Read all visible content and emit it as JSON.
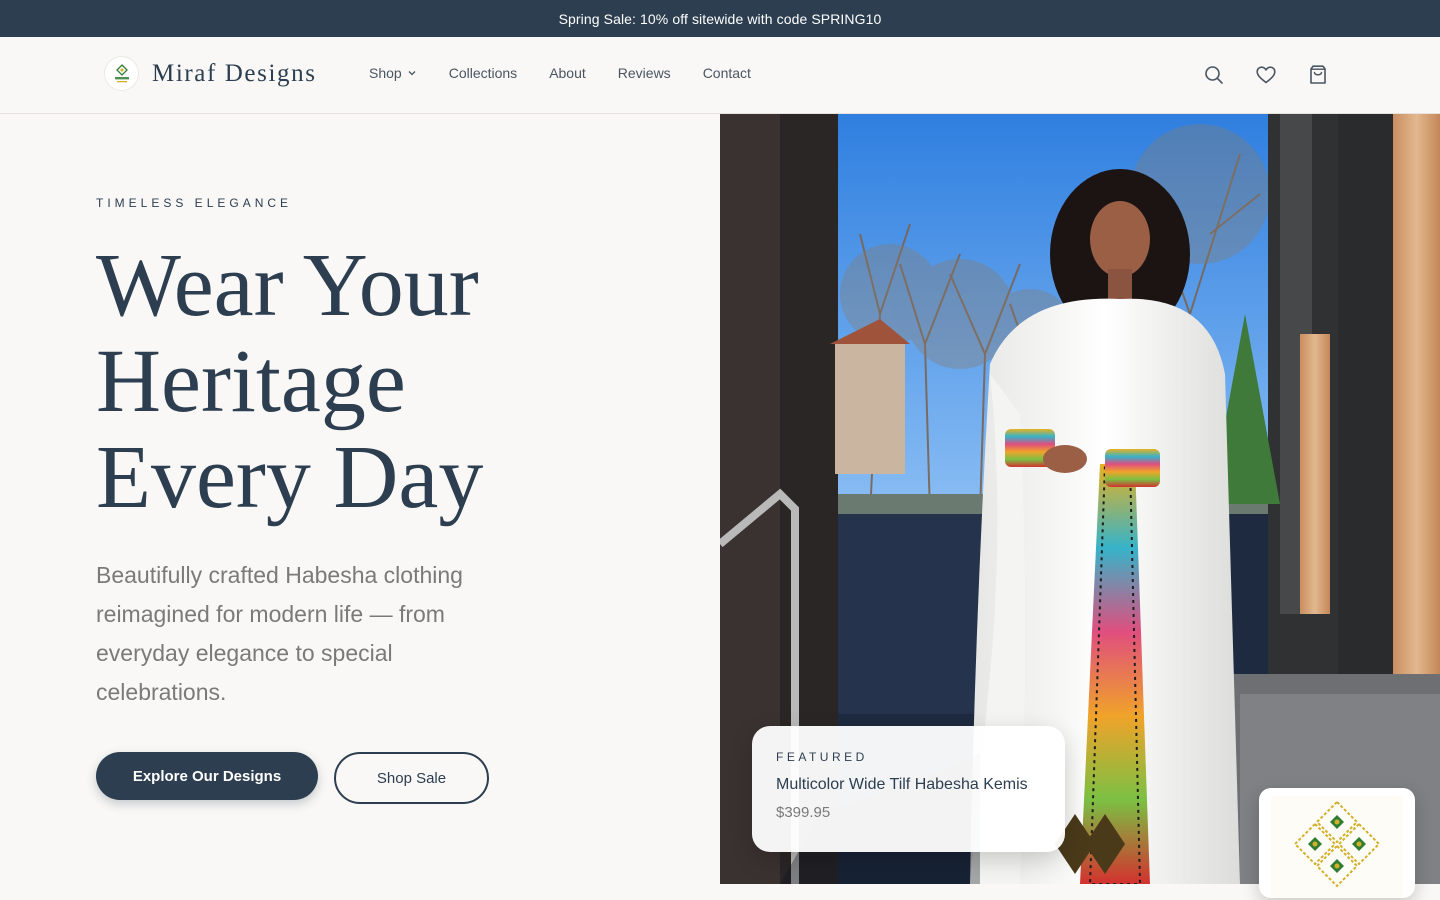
{
  "announcement": {
    "text": "Spring Sale: 10% off sitewide with code SPRING10"
  },
  "brand": {
    "name": "Miraf Designs",
    "logo_text": "Miraf"
  },
  "nav": {
    "items": [
      {
        "label": "Shop",
        "has_dropdown": true
      },
      {
        "label": "Collections"
      },
      {
        "label": "About"
      },
      {
        "label": "Reviews"
      },
      {
        "label": "Contact"
      }
    ]
  },
  "header_icons": [
    "search-icon",
    "heart-icon",
    "shopping-bag-icon"
  ],
  "hero": {
    "eyebrow": "TIMELESS ELEGANCE",
    "title_lines": [
      "Wear Your",
      "Heritage",
      "Every Day"
    ],
    "subtitle": "Beautifully crafted Habesha clothing reimagined for modern life — from everyday elegance to special celebrations.",
    "primary_button": "Explore Our Designs",
    "secondary_button": "Shop Sale"
  },
  "featured": {
    "label": "FEATURED",
    "name": "Multicolor Wide Tilf Habesha Kemis",
    "price": "$399.95"
  },
  "colors": {
    "primary": "#2c3e50",
    "background": "#f9f8f6",
    "muted_text": "#7a7a7a",
    "accent_green": "#2e7d32",
    "accent_gold": "#d4b02a"
  }
}
